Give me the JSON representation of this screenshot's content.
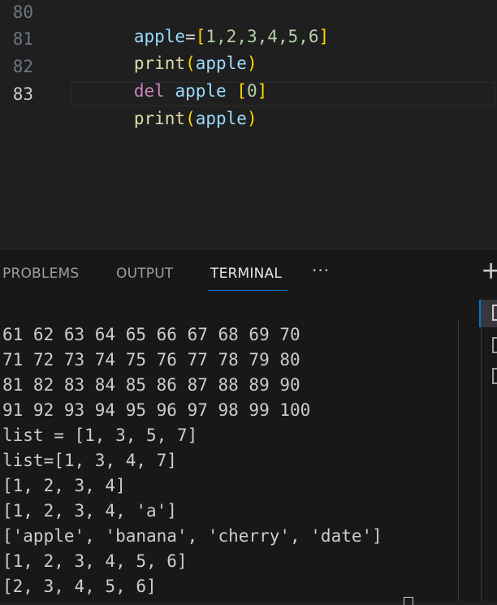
{
  "editor": {
    "lines": [
      {
        "number": "80",
        "tokens": [
          {
            "text": "apple",
            "cls": "t-var"
          },
          {
            "text": "=",
            "cls": "t-op"
          },
          {
            "text": "[",
            "cls": "t-brack"
          },
          {
            "text": "1,2,3,4,5,6",
            "cls": "t-num"
          },
          {
            "text": "]",
            "cls": "t-brack"
          }
        ]
      },
      {
        "number": "81",
        "tokens": [
          {
            "text": "print",
            "cls": "t-fn"
          },
          {
            "text": "(",
            "cls": "t-paren"
          },
          {
            "text": "apple",
            "cls": "t-var"
          },
          {
            "text": ")",
            "cls": "t-paren"
          }
        ]
      },
      {
        "number": "82",
        "tokens": [
          {
            "text": "del",
            "cls": "t-kw"
          },
          {
            "text": " ",
            "cls": "t-op"
          },
          {
            "text": "apple",
            "cls": "t-var"
          },
          {
            "text": " ",
            "cls": "t-op"
          },
          {
            "text": "[",
            "cls": "t-brack"
          },
          {
            "text": "0",
            "cls": "t-num"
          },
          {
            "text": "]",
            "cls": "t-brack"
          }
        ]
      },
      {
        "number": "83",
        "tokens": [
          {
            "text": "print",
            "cls": "t-fn"
          },
          {
            "text": "(",
            "cls": "t-paren"
          },
          {
            "text": "apple",
            "cls": "t-var"
          },
          {
            "text": ")",
            "cls": "t-paren"
          }
        ]
      }
    ]
  },
  "panel": {
    "tabs": [
      {
        "label": "PROBLEMS",
        "active": false
      },
      {
        "label": "OUTPUT",
        "active": false
      },
      {
        "label": "TERMINAL",
        "active": true
      }
    ],
    "more_label": "···",
    "add_label": "+"
  },
  "terminal": {
    "lines": [
      "61 62 63 64 65 66 67 68 69 70",
      "71 72 73 74 75 76 77 78 79 80",
      "81 82 83 84 85 86 87 88 89 90",
      "91 92 93 94 95 96 97 98 99 100",
      "list = [1, 3, 5, 7]",
      "list=[1, 3, 4, 7]",
      "[1, 2, 3, 4]",
      "[1, 2, 3, 4, 'a']",
      "['apple', 'banana', 'cherry', 'date']",
      "[1, 2, 3, 4, 5, 6]",
      "[2, 3, 4, 5, 6]"
    ]
  },
  "icons": {
    "more": "ellipsis-icon",
    "add": "plus-icon",
    "side": "terminal-icon"
  }
}
